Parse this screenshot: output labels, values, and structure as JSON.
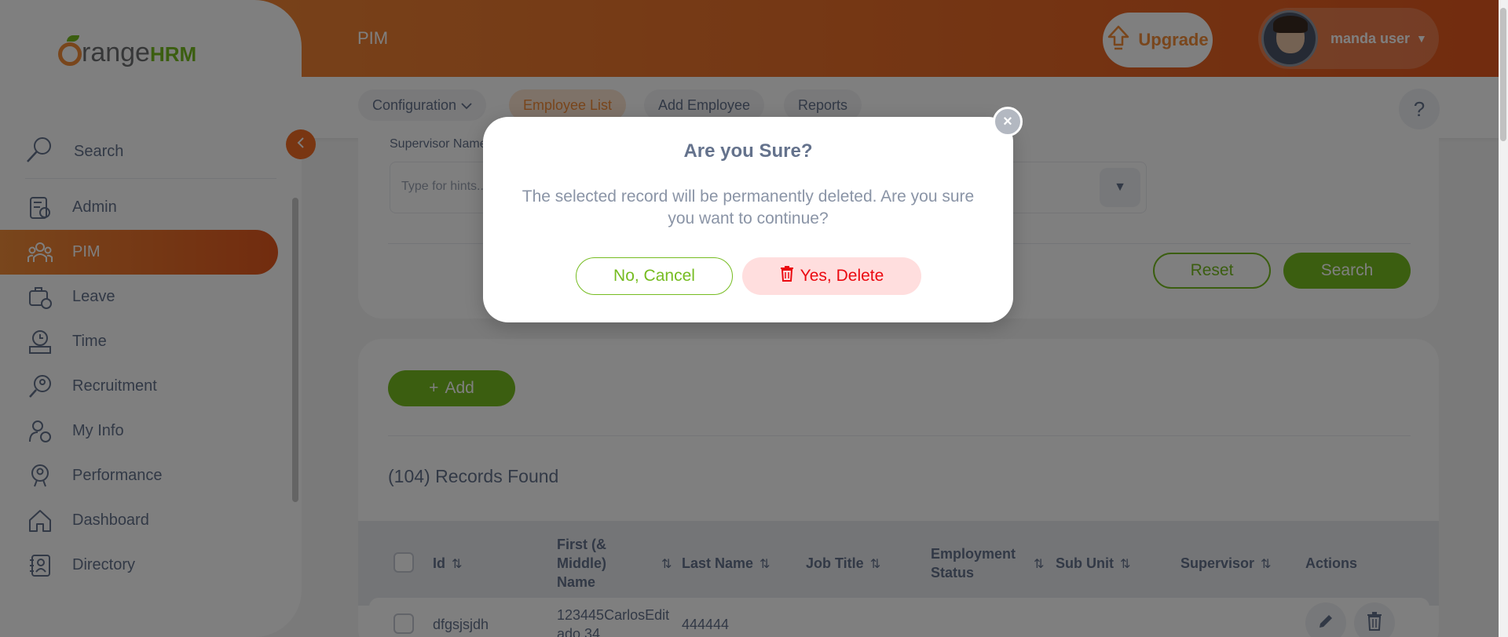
{
  "header": {
    "page_title": "PIM",
    "upgrade_label": "Upgrade",
    "user_name": "manda user"
  },
  "sidebar": {
    "logo_range": "range",
    "logo_hrm": "HRM",
    "search_label": "Search",
    "items": [
      {
        "label": "Admin",
        "icon": "admin-icon"
      },
      {
        "label": "PIM",
        "icon": "pim-icon",
        "active": true
      },
      {
        "label": "Leave",
        "icon": "leave-icon"
      },
      {
        "label": "Time",
        "icon": "time-icon"
      },
      {
        "label": "Recruitment",
        "icon": "recruitment-icon"
      },
      {
        "label": "My Info",
        "icon": "my-info-icon"
      },
      {
        "label": "Performance",
        "icon": "performance-icon"
      },
      {
        "label": "Dashboard",
        "icon": "dashboard-icon"
      },
      {
        "label": "Directory",
        "icon": "directory-icon"
      }
    ]
  },
  "subnav": {
    "tabs": [
      {
        "label": "Configuration"
      },
      {
        "label": "Employee List",
        "active": true
      },
      {
        "label": "Add Employee"
      },
      {
        "label": "Reports"
      }
    ],
    "help_label": "?"
  },
  "filter": {
    "supervisor_label": "Supervisor Name",
    "supervisor_placeholder": "Type for hints...",
    "reset_label": "Reset",
    "search_label": "Search"
  },
  "list": {
    "add_label": "Add",
    "records_found": "(104) Records Found",
    "columns": [
      "Id",
      "First (& Middle) Name",
      "Last Name",
      "Job Title",
      "Employment Status",
      "Sub Unit",
      "Supervisor",
      "Actions"
    ],
    "rows": [
      {
        "id": "dfgsjsjdh",
        "first_name": "123445CarlosEditado 34",
        "last_name": "444444",
        "job_title": "",
        "employment_status": "",
        "sub_unit": "",
        "supervisor": ""
      }
    ]
  },
  "modal": {
    "title": "Are you Sure?",
    "body": "The selected record will be permanently deleted. Are you sure you want to continue?",
    "cancel_label": "No, Cancel",
    "delete_label": "Yes, Delete",
    "close_label": "×"
  },
  "colors": {
    "brand_orange": "#f28c38",
    "brand_green": "#76bc21",
    "danger_red": "#eb0910"
  }
}
